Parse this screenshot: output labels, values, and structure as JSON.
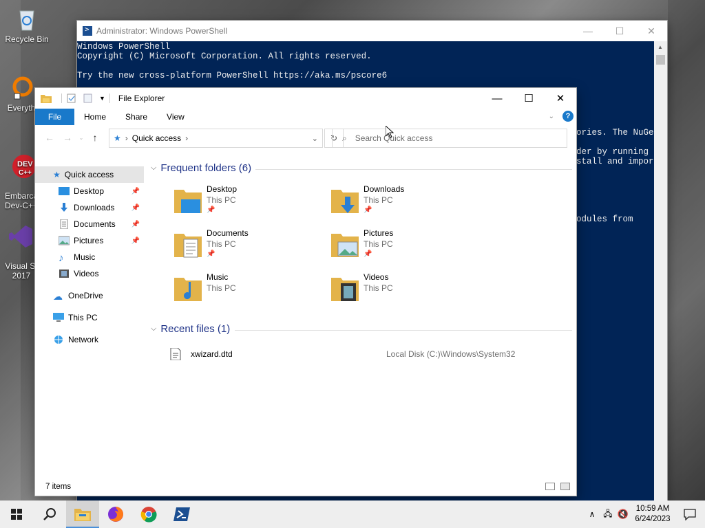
{
  "desktop": {
    "icons": [
      {
        "label": "Recycle Bin"
      },
      {
        "label": "Everyth"
      },
      {
        "label": "Embarca\nDev-C++"
      },
      {
        "label": "Visual St\n2017"
      }
    ]
  },
  "powershell": {
    "title": "Administrator: Windows PowerShell",
    "lines": [
      "Windows PowerShell",
      "Copyright (C) Microsoft Corporation. All rights reserved.",
      "",
      "Try the new cross-platform PowerShell https://aka.ms/pscore6"
    ],
    "right_lines": [
      "ories. The NuGet",
      "der by running",
      "stall and import",
      "odules from"
    ],
    "controls": {
      "minimize": "—",
      "maximize": "☐",
      "close": "✕"
    }
  },
  "explorer": {
    "title": "File Explorer",
    "controls": {
      "minimize": "—",
      "maximize": "☐",
      "close": "✕"
    },
    "ribbon": {
      "file": "File",
      "home": "Home",
      "share": "Share",
      "view": "View",
      "help": "?"
    },
    "address": {
      "path": "Quick access",
      "separator": "›"
    },
    "search": {
      "placeholder": "Search Quick access"
    },
    "sidebar": {
      "quick_access": "Quick access",
      "pinned": [
        "Desktop",
        "Downloads",
        "Documents",
        "Pictures"
      ],
      "unpinned": [
        "Music",
        "Videos"
      ],
      "onedrive": "OneDrive",
      "this_pc": "This PC",
      "network": "Network"
    },
    "frequent": {
      "header": "Frequent folders (6)",
      "items": [
        {
          "name": "Desktop",
          "location": "This PC",
          "pinned": true
        },
        {
          "name": "Downloads",
          "location": "This PC",
          "pinned": true
        },
        {
          "name": "Documents",
          "location": "This PC",
          "pinned": true
        },
        {
          "name": "Pictures",
          "location": "This PC",
          "pinned": true
        },
        {
          "name": "Music",
          "location": "This PC",
          "pinned": false
        },
        {
          "name": "Videos",
          "location": "This PC",
          "pinned": false
        }
      ]
    },
    "recent": {
      "header": "Recent files (1)",
      "items": [
        {
          "name": "xwizard.dtd",
          "path": "Local Disk (C:)\\Windows\\System32"
        }
      ]
    },
    "status": {
      "count": "7 items"
    }
  },
  "taskbar": {
    "time": "10:59 AM",
    "date": "6/24/2023"
  },
  "colors": {
    "accent": "#1979ca",
    "ps_bg": "#012456",
    "header_blue": "#1e3287"
  }
}
